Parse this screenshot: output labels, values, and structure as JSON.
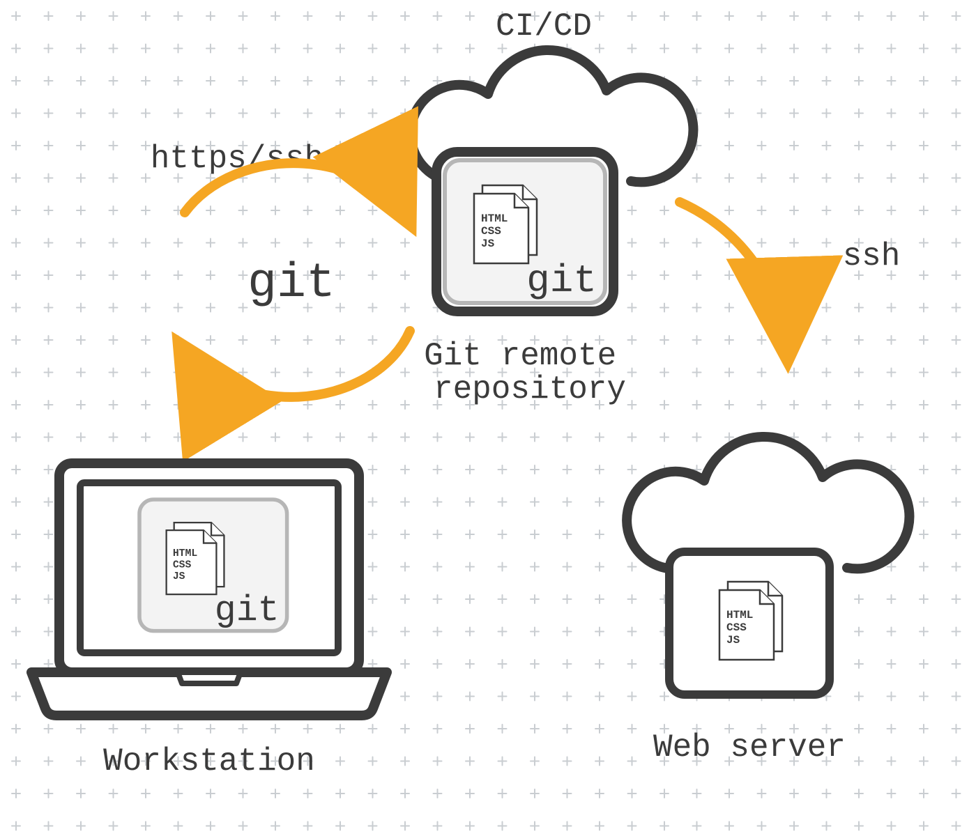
{
  "labels": {
    "cicd": "CI/CD",
    "https_ssh": "https/ssh",
    "ssh": "ssh",
    "git_center": "git",
    "git_remote": "Git remote\nrepository",
    "workstation": "Workstation",
    "web_server": "Web server"
  },
  "git_box": {
    "git_label": "git",
    "doc_lines": [
      "HTML",
      "CSS",
      "JS"
    ]
  },
  "doc": {
    "lines": [
      "HTML",
      "CSS",
      "JS"
    ]
  },
  "colors": {
    "stroke_dark": "#3b3b3b",
    "fill_light": "#f3f3f3",
    "arrow": "#f5a623",
    "grid": "#c9cdd1"
  }
}
